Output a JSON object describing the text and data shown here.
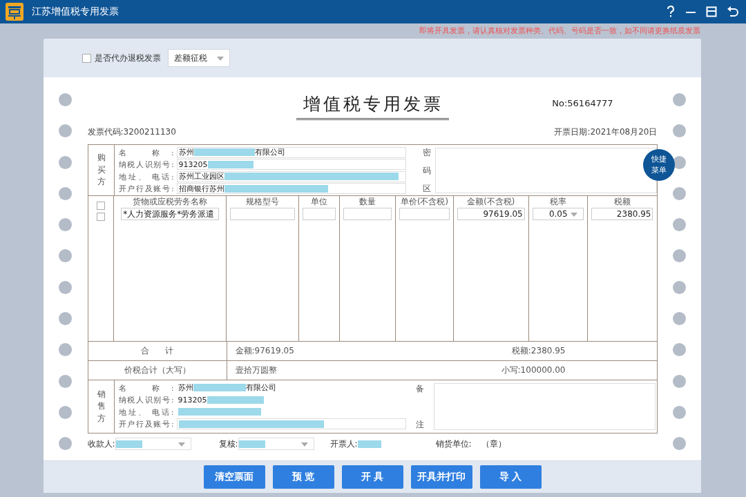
{
  "window": {
    "title": "江苏增值税专用发票"
  },
  "notice": "即将开具发票，请认真核对发票种类、代码、号码是否一致，如不同请更换纸质发票",
  "options": {
    "refund_checkbox": {
      "label": "是否代办退税发票",
      "checked": false
    },
    "tax_mode": {
      "value": "差额征税"
    }
  },
  "invoice": {
    "title": "增值税专用发票",
    "number": "No:56164777",
    "code": "发票代码:3200211130",
    "date": "开票日期:2021年08月20日",
    "buyer": {
      "section_label": "购买方",
      "fields": [
        {
          "label": "名 称:",
          "prefix": "苏州",
          "suffix": "有限公司",
          "redacted": true
        },
        {
          "label": "纳税人识别号:",
          "prefix": "913205",
          "redacted": true
        },
        {
          "label": "地址、 电话:",
          "prefix": "苏州工业园区",
          "redacted": true
        },
        {
          "label": "开户行及账号:",
          "prefix": "招商银行苏州",
          "redacted": true
        }
      ],
      "cipher_label": "密码区"
    },
    "quick_menu": "快捷菜单",
    "columns": [
      "货物或应税劳务名称",
      "规格型号",
      "单位",
      "数量",
      "单价(不含税)",
      "金额(不含税)",
      "税率",
      "税额"
    ],
    "select_all": {
      "checked": false
    },
    "rows": [
      {
        "checked": false,
        "name": "*人力资源服务*劳务派遣",
        "amount": "97619.05",
        "tax_rate": "0.05",
        "tax": "2380.95"
      }
    ],
    "total": {
      "label": "合 计",
      "amount": "金额:97619.05",
      "tax": "税额:2380.95"
    },
    "grand_total": {
      "label": "价税合计（大写）",
      "words": "壹拾万圆整",
      "figure": "小写:100000.00"
    },
    "seller": {
      "section_label": "销售方",
      "fields": [
        {
          "label": "名 称:",
          "prefix": "苏州",
          "suffix": "有限公司",
          "redacted": true,
          "kind": "plain"
        },
        {
          "label": "纳税人识别号:",
          "prefix": "913205",
          "redacted": true,
          "kind": "plain"
        },
        {
          "label": "地址、 电话:",
          "redacted": true,
          "kind": "plain"
        },
        {
          "label": "开户行及账号:",
          "redacted": true,
          "kind": "box"
        }
      ],
      "remarks_label": "备注"
    },
    "footer": [
      {
        "kind": "select",
        "label": "收款人:",
        "redacted": true
      },
      {
        "kind": "select",
        "label": "复核:",
        "redacted": true
      },
      {
        "kind": "text",
        "label": "开票人:",
        "redacted": true
      },
      {
        "kind": "text",
        "label": "销货单位:",
        "value": "（章）"
      }
    ]
  },
  "buttons": [
    "清空票面",
    "预 览",
    "开 具",
    "开具并打印",
    "导 入"
  ]
}
